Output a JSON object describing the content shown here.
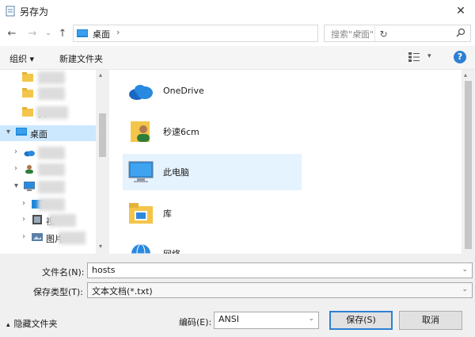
{
  "window": {
    "title": "另存为",
    "close_icon": "close-icon"
  },
  "address": {
    "location": "桌面",
    "separator": "›",
    "search_placeholder": "搜索\"桌面\""
  },
  "toolbar": {
    "organize_label": "组织 ▾",
    "new_folder_label": "新建文件夹",
    "help_label": "?"
  },
  "nav": {
    "items": [
      {
        "label": "",
        "level": 1,
        "icon": "folder-icon"
      },
      {
        "label": "",
        "level": 1,
        "icon": "folder-icon"
      },
      {
        "label": "夹",
        "level": 1,
        "icon": "folder-icon"
      },
      {
        "label": "桌面",
        "level": 0,
        "icon": "desktop-icon",
        "selected": true,
        "expander": "▾"
      },
      {
        "label": "",
        "level": 1,
        "icon": "onedrive-icon",
        "expander": "›"
      },
      {
        "label": "",
        "level": 1,
        "icon": "user-icon",
        "expander": "›"
      },
      {
        "label": "",
        "level": 1,
        "icon": "computer-icon",
        "expander": "▾"
      },
      {
        "label": "",
        "level": 2,
        "icon": "folder-blue-icon",
        "expander": "›"
      },
      {
        "label": "视",
        "level": 2,
        "icon": "video-icon",
        "expander": "›"
      },
      {
        "label": "图片",
        "level": 2,
        "icon": "pictures-icon",
        "expander": "›"
      }
    ]
  },
  "main": {
    "items": [
      {
        "label": "OneDrive",
        "icon": "onedrive-icon"
      },
      {
        "label": "秒速6cm",
        "icon": "user-folder-icon"
      },
      {
        "label": "此电脑",
        "icon": "computer-icon",
        "selected": true
      },
      {
        "label": "库",
        "icon": "library-icon"
      },
      {
        "label": "网络",
        "icon": "network-icon"
      }
    ]
  },
  "form": {
    "filename_label": "文件名(N):",
    "filename_value": "hosts",
    "filetype_label": "保存类型(T):",
    "filetype_value": "文本文档(*.txt)",
    "hide_folders_label": "隐藏文件夹",
    "encoding_label": "编码(E):",
    "encoding_value": "ANSI",
    "save_label": "保存(S)",
    "cancel_label": "取消"
  },
  "colors": {
    "accent": "#2f7fd3",
    "selection": "#cce8ff",
    "hover": "#e5f3ff"
  }
}
